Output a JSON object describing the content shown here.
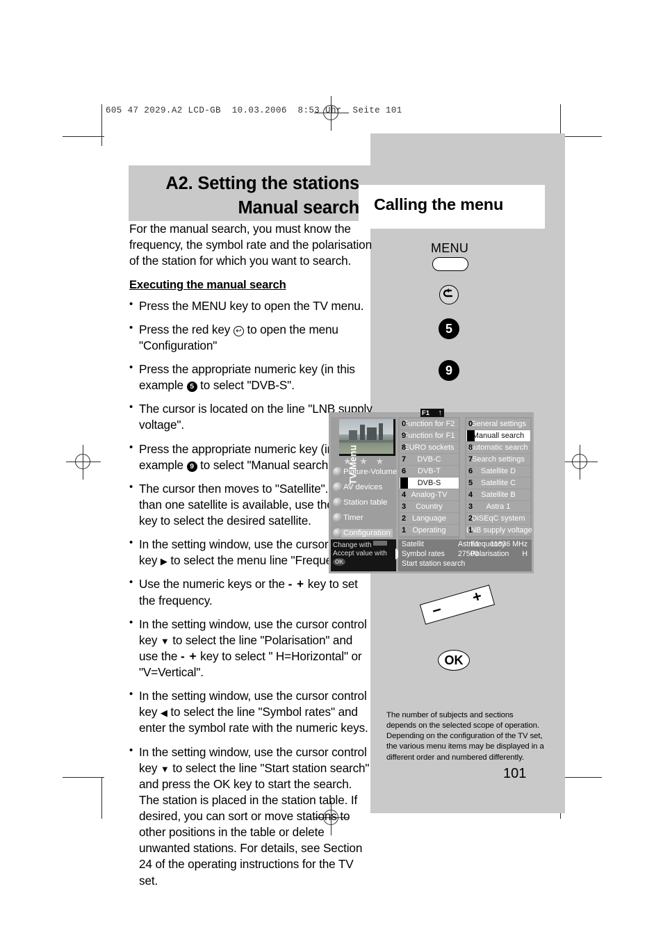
{
  "prepress": {
    "header_line": "605 47 2029.A2 LCD-GB  10.03.2006  8:53 Uhr  Seite 101"
  },
  "headings": {
    "left_line1": "A2. Setting the stations",
    "left_line2": "Manual search",
    "right": "Calling the menu"
  },
  "intro": "For the manual search, you must know the frequency, the symbol rate and the polarisation of the station for which you want to search.",
  "subheading": "Executing the manual search",
  "steps": [
    {
      "id": "step-menu",
      "parts": [
        {
          "t": "Press the MENU key to open the TV menu."
        }
      ]
    },
    {
      "id": "step-red-key",
      "parts": [
        {
          "t": "Press the red key "
        },
        {
          "icon": "return-arrow-icon"
        },
        {
          "t": " to open the menu \"Configuration\""
        }
      ]
    },
    {
      "id": "step-dvbs",
      "parts": [
        {
          "t": "Press the appropriate numeric key (in this example "
        },
        {
          "key": "5"
        },
        {
          "t": " to select \"DVB-S\"."
        }
      ]
    },
    {
      "id": "step-cursor-lnb",
      "parts": [
        {
          "t": "The cursor is located on the line \"LNB supply voltage\"."
        }
      ]
    },
    {
      "id": "step-manual-search",
      "parts": [
        {
          "t": "Press the appropriate numeric key (in this example "
        },
        {
          "key": "9"
        },
        {
          "t": " to select \"Manual search\"."
        }
      ]
    },
    {
      "id": "step-satellite",
      "parts": [
        {
          "t": "The cursor then moves to \"Satellite\". If more than one satellite is available, use the "
        },
        {
          "pm": "- +"
        },
        {
          "t": " key to select the desired satellite."
        }
      ]
    },
    {
      "id": "step-frequency-line",
      "parts": [
        {
          "t": "In the setting window, use the cursor control key "
        },
        {
          "arrow": "▶"
        },
        {
          "t": " to select the menu line \"Frequency\"."
        }
      ]
    },
    {
      "id": "step-set-frequency",
      "parts": [
        {
          "t": " Use the numeric keys or the "
        },
        {
          "pm": "- +"
        },
        {
          "t": " key to set the frequency."
        }
      ]
    },
    {
      "id": "step-polarisation",
      "parts": [
        {
          "t": "In the setting window, use the cursor control key "
        },
        {
          "arrow": "▼"
        },
        {
          "t": " to select the line \"Polarisation\" and use the "
        },
        {
          "pm": "- +"
        },
        {
          "t": " key to select \" H=Horizontal\" or \"V=Vertical\"."
        }
      ]
    },
    {
      "id": "step-symbol-rate",
      "parts": [
        {
          "t": "In the setting window, use the cursor control key "
        },
        {
          "arrow": "◀"
        },
        {
          "t": " to select the line \"Symbol rates\" and enter the symbol rate with the numeric keys."
        }
      ]
    },
    {
      "id": "step-start-search",
      "parts": [
        {
          "t": "In the setting window, use the cursor control key "
        },
        {
          "arrow": "▼"
        },
        {
          "t": " to select the line \"Start station search\" and press the OK key to start the search. The station is placed in the station table. If desired, you can sort or move stations to other positions in the table or delete unwanted stations. For details, see Section 24 of the operating instructions for the TV set."
        }
      ]
    }
  ],
  "remote": {
    "menu_label": "MENU",
    "red_key_icon": "return-arrow-icon",
    "key_5": "5",
    "key_9": "9",
    "rocker_minus": "−",
    "rocker_plus": "+",
    "ok_label": "OK"
  },
  "footnote": "The number of subjects and sections depends on the selected scope of operation. Depending on the configuration of the TV set, the various menu items may be displayed in a different order and numbered differently.",
  "page_number": "101",
  "osd": {
    "f1_badge": "F1",
    "f1_arrow": "↑",
    "sidebar_title": "TV-Menu",
    "stars": "★ ★ ★",
    "sidebar_items": [
      {
        "label": "Picture-Volume",
        "selected": false
      },
      {
        "label": "AV devices",
        "selected": false
      },
      {
        "label": "Station table",
        "selected": false
      },
      {
        "label": "Timer",
        "selected": false
      },
      {
        "label": "Configuration",
        "selected": true
      }
    ],
    "column_middle": [
      {
        "num": "0",
        "label": "Function for F2",
        "selected": false
      },
      {
        "num": "9",
        "label": "Function for F1",
        "selected": false
      },
      {
        "num": "8",
        "label": "EURO sockets",
        "selected": false
      },
      {
        "num": "7",
        "label": "DVB-C",
        "selected": false
      },
      {
        "num": "6",
        "label": "DVB-T",
        "selected": false
      },
      {
        "num": "5",
        "label": "DVB-S",
        "selected": true
      },
      {
        "num": "4",
        "label": "Analog-TV",
        "selected": false
      },
      {
        "num": "3",
        "label": "Country",
        "selected": false
      },
      {
        "num": "2",
        "label": "Language",
        "selected": false
      },
      {
        "num": "1",
        "label": "Operating",
        "selected": false
      }
    ],
    "column_right": [
      {
        "num": "0",
        "label": "General settings",
        "selected": false
      },
      {
        "num": "9",
        "label": "Manuall search",
        "selected": true
      },
      {
        "num": "8",
        "label": "Automatic search",
        "selected": false
      },
      {
        "num": "7",
        "label": "Search settings",
        "selected": false
      },
      {
        "num": "6",
        "label": "Satellite D",
        "selected": false
      },
      {
        "num": "5",
        "label": "Satellite C",
        "selected": false
      },
      {
        "num": "4",
        "label": "Satellite B",
        "selected": false
      },
      {
        "num": "3",
        "label": "Astra 1",
        "selected": false
      },
      {
        "num": "2",
        "label": "DiSEqC system",
        "selected": false
      },
      {
        "num": "1",
        "label": "LNB supply voltage",
        "selected": false
      }
    ],
    "hint": {
      "line1": "Change with",
      "line2": "Accept value with",
      "ok": "OK"
    },
    "settings": {
      "satellite_label": "Satellit",
      "satellite_value": "Astra1",
      "frequency_label": "Frequency",
      "frequency_value": "11836 MHz",
      "symbol_label": "Symbol rates",
      "symbol_value": "27500",
      "polarisation_label": "Polarisation",
      "polarisation_value": "H",
      "start_label": "Start station search"
    }
  },
  "colors": {
    "panel_gray": "#c9c9c9",
    "osd_gray": "#a9a9a9",
    "osd_dark": "#151515"
  }
}
